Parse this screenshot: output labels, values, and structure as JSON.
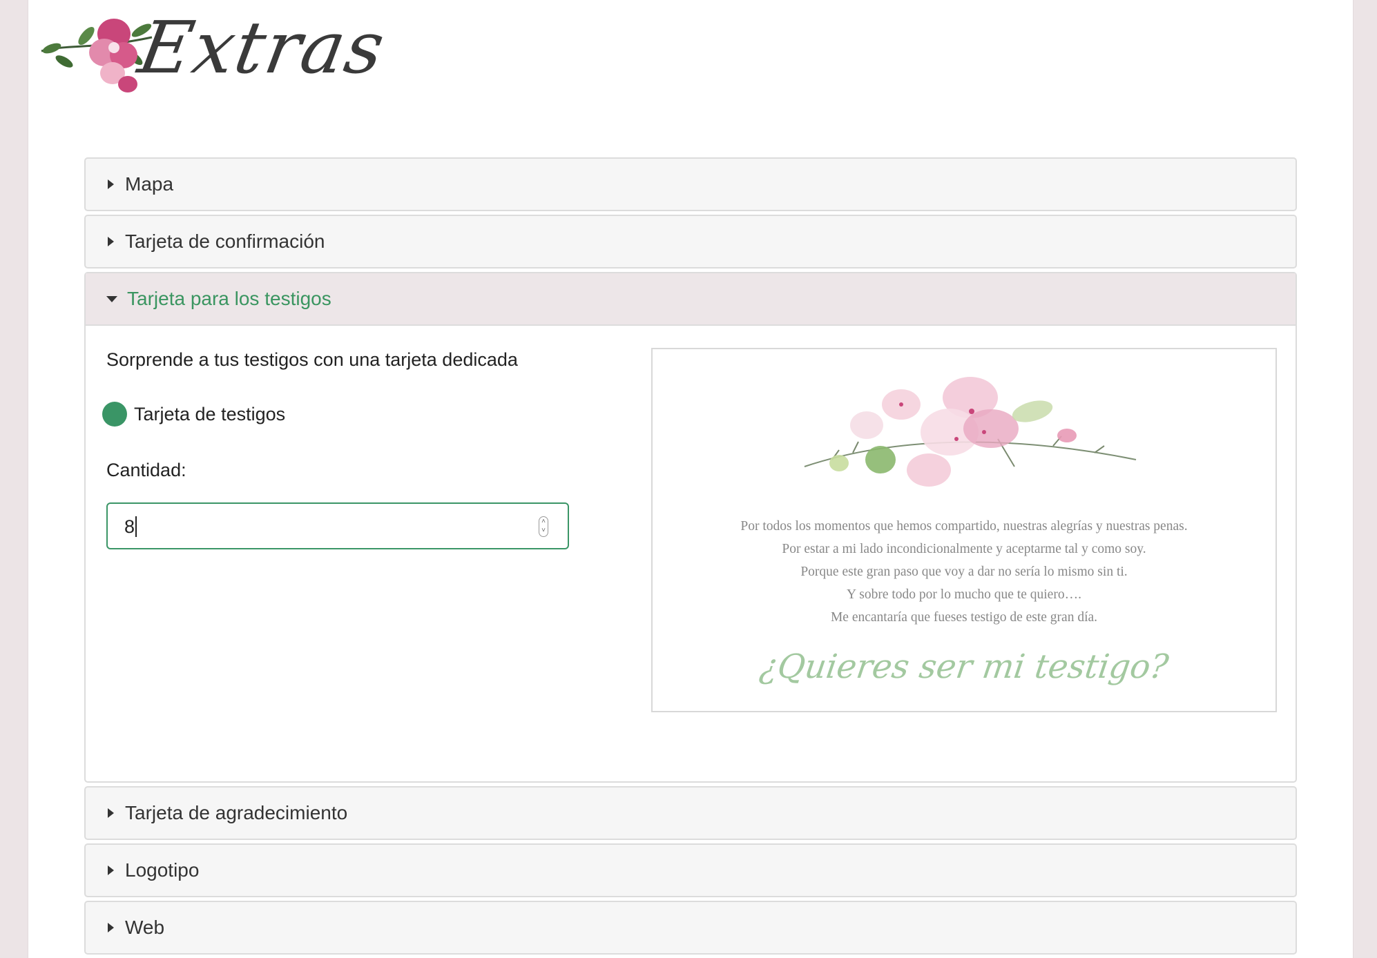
{
  "header": {
    "logo_text": "Extras"
  },
  "panels": [
    {
      "label": "Mapa"
    },
    {
      "label": "Tarjeta de confirmación"
    },
    {
      "label": "Tarjeta para los testigos"
    },
    {
      "label": "Tarjeta de agradecimiento"
    },
    {
      "label": "Logotipo"
    },
    {
      "label": "Web"
    }
  ],
  "testigos": {
    "intro": "Sorprende a tus testigos con una tarjeta dedicada",
    "option_label": "Tarjeta de testigos",
    "quantity_label": "Cantidad:",
    "quantity_value": "8",
    "card": {
      "poem": [
        "Por todos los momentos que hemos compartido, nuestras alegrías y nuestras penas.",
        "Por estar a mi lado incondicionalmente y aceptarme tal y como soy.",
        "Porque este gran paso que voy a dar no sería lo mismo sin ti.",
        "Y sobre todo por lo mucho que te quiero….",
        "Me encantaría que fueses testigo de este gran día."
      ],
      "question": "¿Quieres ser mi testigo?"
    }
  },
  "colors": {
    "accent": "#3a9566",
    "open_header_bg": "#ede6e8",
    "page_bg": "#ece4e6"
  }
}
